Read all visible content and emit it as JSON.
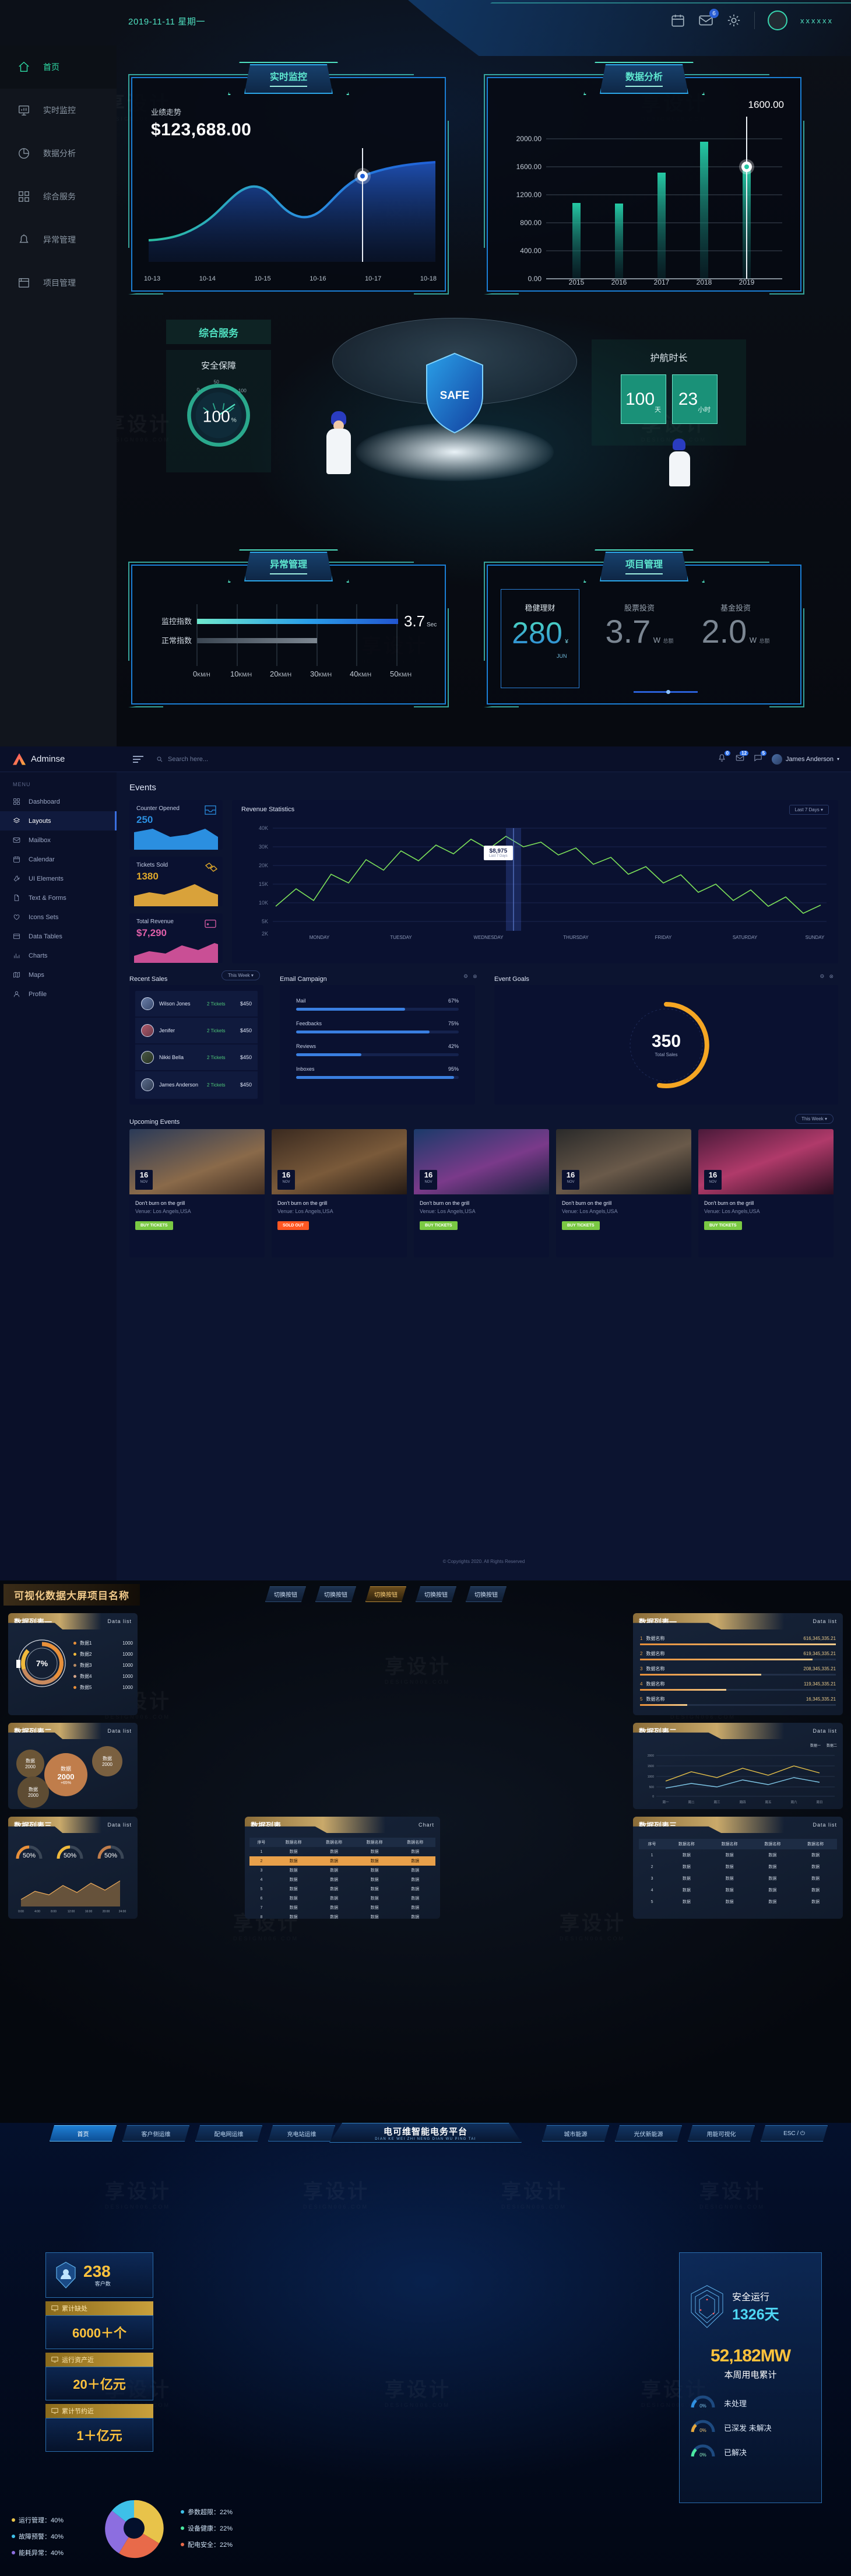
{
  "section1": {
    "header": {
      "date": "2019-11-11 星期一",
      "mail_badge": "6",
      "username": "xxxxxx",
      "icons": [
        "calendar-icon",
        "mail-icon",
        "gear-icon"
      ]
    },
    "sidebar": [
      {
        "label": "首页",
        "icon": "home-icon",
        "active": true
      },
      {
        "label": "实时监控",
        "icon": "monitor-icon",
        "active": false
      },
      {
        "label": "数据分析",
        "icon": "pie-chart-icon",
        "active": false
      },
      {
        "label": "综合服务",
        "icon": "grid-icon",
        "active": false
      },
      {
        "label": "异常管理",
        "icon": "alert-icon",
        "active": false
      },
      {
        "label": "项目管理",
        "icon": "folder-icon",
        "active": false
      }
    ],
    "panel_monitor": {
      "tab": "实时监控",
      "label": "业绩走势",
      "value": "$123,688.00"
    },
    "panel_analysis": {
      "tab": "数据分析",
      "callout": "1600.00"
    },
    "panel_service": {
      "tab": "综合服务",
      "sub": "安全保障",
      "gauge_value": "100",
      "gauge_unit": "%",
      "gauge_min": "0",
      "gauge_mid": "50",
      "gauge_max": "100",
      "shield_text": "SAFE"
    },
    "panel_escort": {
      "title": "护航时长",
      "days": "100",
      "days_unit": "天",
      "hours": "23",
      "hours_unit": "小时"
    },
    "panel_abnormal": {
      "tab": "异常管理",
      "row1": "监控指数",
      "row2": "正常指数",
      "value": "3.7",
      "unit": "Sec"
    },
    "panel_project": {
      "tab": "项目管理",
      "items": [
        {
          "name": "稳健理财",
          "value": "280",
          "unit": "¥",
          "sub": "JUN"
        },
        {
          "name": "股票投资",
          "value": "3.7",
          "unit": "W",
          "sub": "总额"
        },
        {
          "name": "基金投资",
          "value": "2.0",
          "unit": "W",
          "sub": "总额"
        }
      ]
    }
  },
  "section2": {
    "brand": "Adminse",
    "search_placeholder": "Search here...",
    "notif_badge": "0",
    "mail_badge": "12",
    "bell_badge": "5",
    "user": "James Anderson",
    "menu_header": "MENU",
    "menu": [
      {
        "label": "Dashboard",
        "icon": "grid-icon",
        "active": false
      },
      {
        "label": "Layouts",
        "icon": "layers-icon",
        "active": true
      },
      {
        "label": "Mailbox",
        "icon": "mail-icon",
        "active": false
      },
      {
        "label": "Calendar",
        "icon": "calendar-icon",
        "active": false
      },
      {
        "label": "UI Elements",
        "icon": "wrench-icon",
        "active": false
      },
      {
        "label": "Text & Forms",
        "icon": "file-icon",
        "active": false
      },
      {
        "label": "Icons Sets",
        "icon": "heart-icon",
        "active": false
      },
      {
        "label": "Data Tables",
        "icon": "table-icon",
        "active": false
      },
      {
        "label": "Charts",
        "icon": "bar-chart-icon",
        "active": false
      },
      {
        "label": "Maps",
        "icon": "map-icon",
        "active": false
      },
      {
        "label": "Profile",
        "icon": "user-icon",
        "active": false
      }
    ],
    "page_title": "Events",
    "stats": [
      {
        "label": "Counter Opened",
        "value": "250",
        "color": "#2b8fe0",
        "icon": "inbox-icon"
      },
      {
        "label": "Tickets Sold",
        "value": "1380",
        "color": "#e0a92b",
        "icon": "ticket-icon"
      },
      {
        "label": "Total Revenue",
        "value": "$7,290",
        "color": "#e05fa9",
        "icon": "wallet-icon"
      }
    ],
    "revenue": {
      "title": "Revenue Statistics",
      "range": "Last 7 Days",
      "tooltip_value": "$8,975",
      "tooltip_label": "Last 7 Days"
    },
    "recent_sales": {
      "title": "Recent Sales",
      "range": "This Week",
      "rows": [
        {
          "name": "Wilson Jones",
          "tickets": "2 Tickets",
          "amount": "$450"
        },
        {
          "name": "Jenifer",
          "tickets": "2 Tickets",
          "amount": "$450"
        },
        {
          "name": "Nikki Bella",
          "tickets": "2 Tickets",
          "amount": "$450"
        },
        {
          "name": "James Anderson",
          "tickets": "2 Tickets",
          "amount": "$450"
        }
      ]
    },
    "email_campaign": {
      "title": "Email Campaign",
      "rows": [
        {
          "label": "Mail",
          "pct": "67%",
          "v": 67
        },
        {
          "label": "Feedbacks",
          "pct": "75%",
          "v": 75
        },
        {
          "label": "Reviews",
          "pct": "42%",
          "v": 42
        },
        {
          "label": "Inboxes",
          "pct": "95%",
          "v": 95
        }
      ]
    },
    "event_goals": {
      "title": "Event Goals",
      "value": "350",
      "sub": "Total Sales"
    },
    "upcoming": {
      "title": "Upcoming Events",
      "range": "This Week",
      "cards": [
        {
          "day": "16",
          "month": "NOV",
          "title": "Don't burn on the grill",
          "venue": "Venue: Los Angels,USA",
          "btn": "BUY TICKETS",
          "btn_color": "#7ac943"
        },
        {
          "day": "16",
          "month": "NOV",
          "title": "Don't burn on the grill",
          "venue": "Venue: Los Angels,USA",
          "btn": "SOLD OUT",
          "btn_color": "#ff5722"
        },
        {
          "day": "16",
          "month": "NOV",
          "title": "Don't burn on the grill",
          "venue": "Venue: Los Angels,USA",
          "btn": "BUY TICKETS",
          "btn_color": "#7ac943"
        },
        {
          "day": "16",
          "month": "NOV",
          "title": "Don't burn on the grill",
          "venue": "Venue: Los Angels,USA",
          "btn": "BUY TICKETS",
          "btn_color": "#7ac943"
        },
        {
          "day": "16",
          "month": "NOV",
          "title": "Don't burn on the grill",
          "venue": "Venue: Los Angels,USA",
          "btn": "BUY TICKETS",
          "btn_color": "#7ac943"
        }
      ]
    },
    "footer": "© Copyrights 2020. All Rights Reserved"
  },
  "section3": {
    "title": "可视化数据大屏项目名称",
    "buttons": [
      {
        "label": "切换按钮",
        "active": false
      },
      {
        "label": "切换按钮",
        "active": false
      },
      {
        "label": "切换按钮",
        "active": true
      },
      {
        "label": "切换按钮",
        "active": false
      },
      {
        "label": "切换按钮",
        "active": false
      }
    ],
    "list1": {
      "name": "数据列表一",
      "en": "Data list",
      "donut": "7%",
      "rows": [
        {
          "label": "数据1",
          "value": "1000",
          "color": "#e8903a"
        },
        {
          "label": "数据2",
          "value": "1000",
          "color": "#f0b93c"
        },
        {
          "label": "数据3",
          "value": "1000",
          "color": "#b58a63"
        },
        {
          "label": "数据4",
          "value": "1000",
          "color": "#d6a588"
        },
        {
          "label": "数据5",
          "value": "1000",
          "color": "#e8903a"
        }
      ]
    },
    "list2": {
      "name": "数据列表二",
      "en": "Data list",
      "bubbles": [
        {
          "label": "数据",
          "value": "2000",
          "delta": "",
          "size": 54,
          "color": "#6b5536"
        },
        {
          "label": "数据",
          "value": "2000",
          "delta": "+65%",
          "size": 86,
          "color": "#c07d4b"
        },
        {
          "label": "数据",
          "value": "2000",
          "delta": "",
          "size": 58,
          "color": "#7a6040"
        },
        {
          "label": "数据",
          "value": "2000",
          "delta": "",
          "size": 62,
          "color": "#5e4c33"
        }
      ]
    },
    "list3": {
      "name": "数据列表三",
      "en": "Data list",
      "gauges": [
        {
          "v": "50%"
        },
        {
          "v": "50%"
        },
        {
          "v": "50%"
        }
      ],
      "xticks": [
        "0:00",
        "4:00",
        "8:00",
        "12:00",
        "16:00",
        "20:00",
        "24:00"
      ]
    },
    "rlist1": {
      "name": "数据列表一",
      "en": "Data list",
      "rows": [
        {
          "rank": "1",
          "label": "数据名称",
          "value": "616,345,335.21",
          "w": 100
        },
        {
          "rank": "2",
          "label": "数据名称",
          "value": "619,345,335.21",
          "w": 88
        },
        {
          "rank": "3",
          "label": "数据名称",
          "value": "208,345,335.21",
          "w": 62
        },
        {
          "rank": "4",
          "label": "数据名称",
          "value": "119,345,335.21",
          "w": 44
        },
        {
          "rank": "5",
          "label": "数据名称",
          "value": "16,345,335.21",
          "w": 24
        }
      ]
    },
    "rlist2": {
      "name": "数据列表二",
      "en": "Data list",
      "legend": [
        "数据一",
        "数据二"
      ],
      "xticks": [
        "周一",
        "周二",
        "周三",
        "周四",
        "周五",
        "周六",
        "周日"
      ],
      "yticks": [
        "2000",
        "1500",
        "1000",
        "500",
        "0"
      ]
    },
    "rlist3": {
      "name": "数据列表三",
      "en": "Data list",
      "headers": [
        "序号",
        "数据名称",
        "数据名称",
        "数据名称",
        "数据名称"
      ],
      "rows": [
        [
          "1",
          "数据",
          "数据",
          "数据",
          "数据"
        ],
        [
          "2",
          "数据",
          "数据",
          "数据",
          "数据"
        ],
        [
          "3",
          "数据",
          "数据",
          "数据",
          "数据"
        ],
        [
          "4",
          "数据",
          "数据",
          "数据",
          "数据"
        ],
        [
          "5",
          "数据",
          "数据",
          "数据",
          "数据"
        ]
      ]
    },
    "center": {
      "name": "数据列表",
      "en": "Chart",
      "headers": [
        "序号",
        "数据名称",
        "数据名称",
        "数据名称",
        "数据名称"
      ],
      "rows": [
        [
          "1",
          "数据",
          "数据",
          "数据",
          "数据"
        ],
        [
          "2",
          "数据",
          "数据",
          "数据",
          "数据"
        ],
        [
          "3",
          "数据",
          "数据",
          "数据",
          "数据"
        ],
        [
          "4",
          "数据",
          "数据",
          "数据",
          "数据"
        ],
        [
          "5",
          "数据",
          "数据",
          "数据",
          "数据"
        ],
        [
          "6",
          "数据",
          "数据",
          "数据",
          "数据"
        ],
        [
          "7",
          "数据",
          "数据",
          "数据",
          "数据"
        ],
        [
          "8",
          "数据",
          "数据",
          "数据",
          "数据"
        ]
      ]
    }
  },
  "section4": {
    "title": "电可维智能电务平台",
    "title_en": "DIAN KE WEI ZHI NENG DIAN WU PING TAI",
    "nav_left": [
      {
        "label": "首页",
        "active": true
      },
      {
        "label": "客户侧运维",
        "active": false
      },
      {
        "label": "配电网运维",
        "active": false
      },
      {
        "label": "充电站运维",
        "active": false
      }
    ],
    "nav_right": [
      {
        "label": "城市能源",
        "active": false
      },
      {
        "label": "光伏新能源",
        "active": false
      },
      {
        "label": "用能可视化",
        "active": false
      },
      {
        "label": "ESC / ⏻",
        "active": false
      }
    ],
    "left_kpis": [
      {
        "value": "238",
        "label": "客户数",
        "type": "badge"
      },
      {
        "bar": "累计缺处",
        "value": "6000＋个"
      },
      {
        "bar": "运行资产近",
        "value": "20＋亿元"
      },
      {
        "bar": "累计节约近",
        "value": "1＋亿元"
      }
    ],
    "right_panel": {
      "run_label": "安全运行",
      "run_days": "1326天",
      "power": "52,182MW",
      "power_label": "本周用电累计",
      "status": [
        {
          "pct": "0%",
          "label": "未处理"
        },
        {
          "pct": "0%",
          "label": "已深发 未解决"
        },
        {
          "pct": "0%",
          "label": "已解决"
        }
      ]
    },
    "bottom_legend": [
      {
        "label": "运行管理：40%",
        "color": "#e8c34a"
      },
      {
        "label": "故障预警：40%",
        "color": "#3ec0e8"
      },
      {
        "label": "能耗异常：40%",
        "color": "#8c6ee0"
      },
      {
        "label": "参数超限：22%",
        "color": "#3ec0e8"
      },
      {
        "label": "设备健康：22%",
        "color": "#4ae8a0"
      },
      {
        "label": "配电安全：22%",
        "color": "#e86a4a"
      }
    ]
  }
}
